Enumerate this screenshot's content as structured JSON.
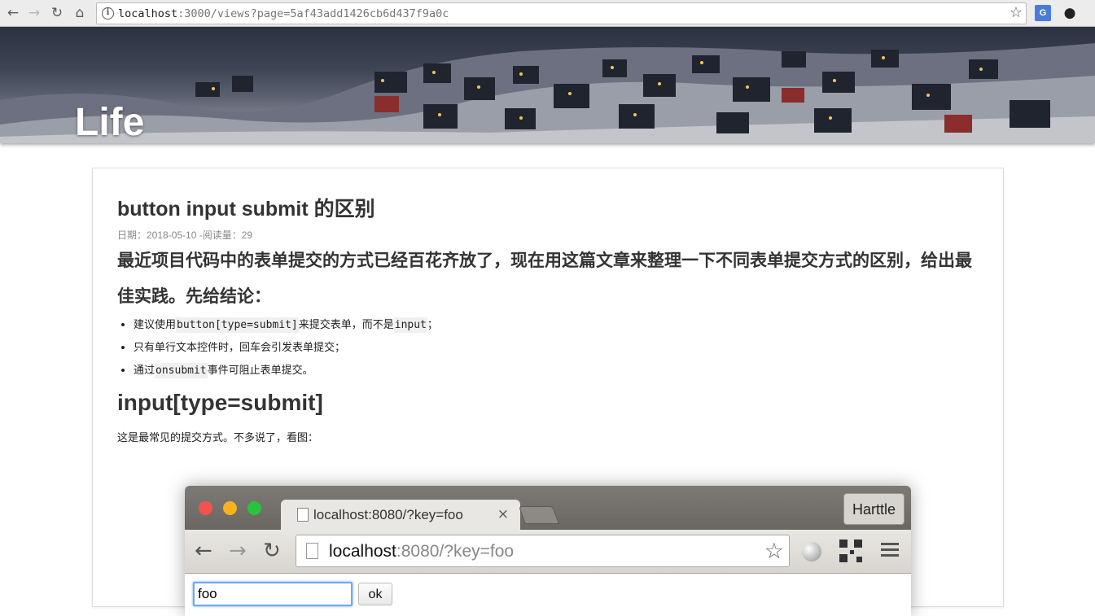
{
  "browser": {
    "url_host": "localhost",
    "url_rest": ":3000/views?page=5af43add1426cb6d437f9a0c",
    "translate_ext": "G"
  },
  "banner": {
    "title": "Life"
  },
  "post": {
    "title": "button input submit 的区别",
    "meta_date": "日期：2018-05-10",
    "meta_sep": " -",
    "meta_views": "阅读量：29",
    "lead": "最近项目代码中的表单提交的方式已经百花齐放了，现在用这篇文章来整理一下不同表单提交方式的区别，给出最佳实践。先给结论：",
    "bullets": [
      {
        "pre": "建议使用",
        "code": "button[type=submit]",
        "mid": "来提交表单，而不是",
        "code2": "input",
        "post": "；"
      },
      {
        "pre": "只有单行文本控件时，回车会引发表单提交；"
      },
      {
        "pre": "通过",
        "code": "onsubmit",
        "post": "事件可阻止表单提交。"
      }
    ],
    "h2": "input[type=submit]",
    "paragraph": "这是最常见的提交方式。不多说了，看图："
  },
  "figure": {
    "tab_label": "localhost:8080/?key=foo",
    "tab_close": "×",
    "user_button": "Harttle",
    "url_host": "localhost",
    "url_rest": ":8080/?key=foo",
    "input_value": "foo",
    "ok_button": "ok",
    "traffic_colors": [
      "#f4534d",
      "#f6b21f",
      "#29c33f"
    ]
  }
}
